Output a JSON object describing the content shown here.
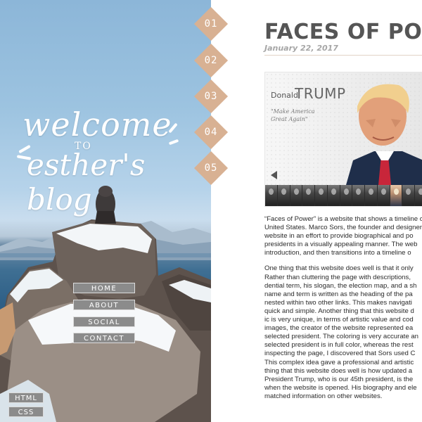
{
  "welcome": {
    "line1": "welcome",
    "line2": "TO",
    "line3": "esther's blog"
  },
  "menu": [
    "HOME",
    "ABOUT",
    "SOCIAL",
    "CONTACT"
  ],
  "tags": [
    "HTML",
    "CSS"
  ],
  "diamonds": [
    "01",
    "02",
    "03",
    "04",
    "05"
  ],
  "accent_color": "#d8b193",
  "post": {
    "title": "FACES OF POWER",
    "date": "January 22, 2017",
    "screenshot": {
      "first_name": "Donald",
      "last_name": "TRUMP",
      "quote": "\"Make America Great Again\""
    },
    "paragraph1": [
      "“Faces of Power” is a website that shows a timeline of",
      "United States. Marco Sors, the founder and designer",
      "website in an effort to provide biographical and po",
      "presidents in a visually appealing manner. The web",
      "introduction, and then transitions into a timeline o"
    ],
    "paragraph2": [
      "One thing that this website does well is that it only",
      "Rather than cluttering the page with descriptions,",
      "dential term, his slogan, the election map, and a sh",
      "name and term is written as the heading of the pa",
      "nested within two other links. This makes navigati",
      "quick and simple. Another thing that this website d",
      "ic is very unique, in terms of artistic value and cod",
      "images, the creator of the website represented ea",
      "selected president. The coloring is very accurate an",
      "selected president is in full color, whereas the rest",
      "inspecting the page, I discovered that Sors used C",
      "This complex idea gave a professional and artistic",
      "thing that this website does well is how updated a",
      "President Trump, who is our 45th president, is the",
      "when the website is opened. His biography and ele",
      "matched information on other websites."
    ]
  }
}
